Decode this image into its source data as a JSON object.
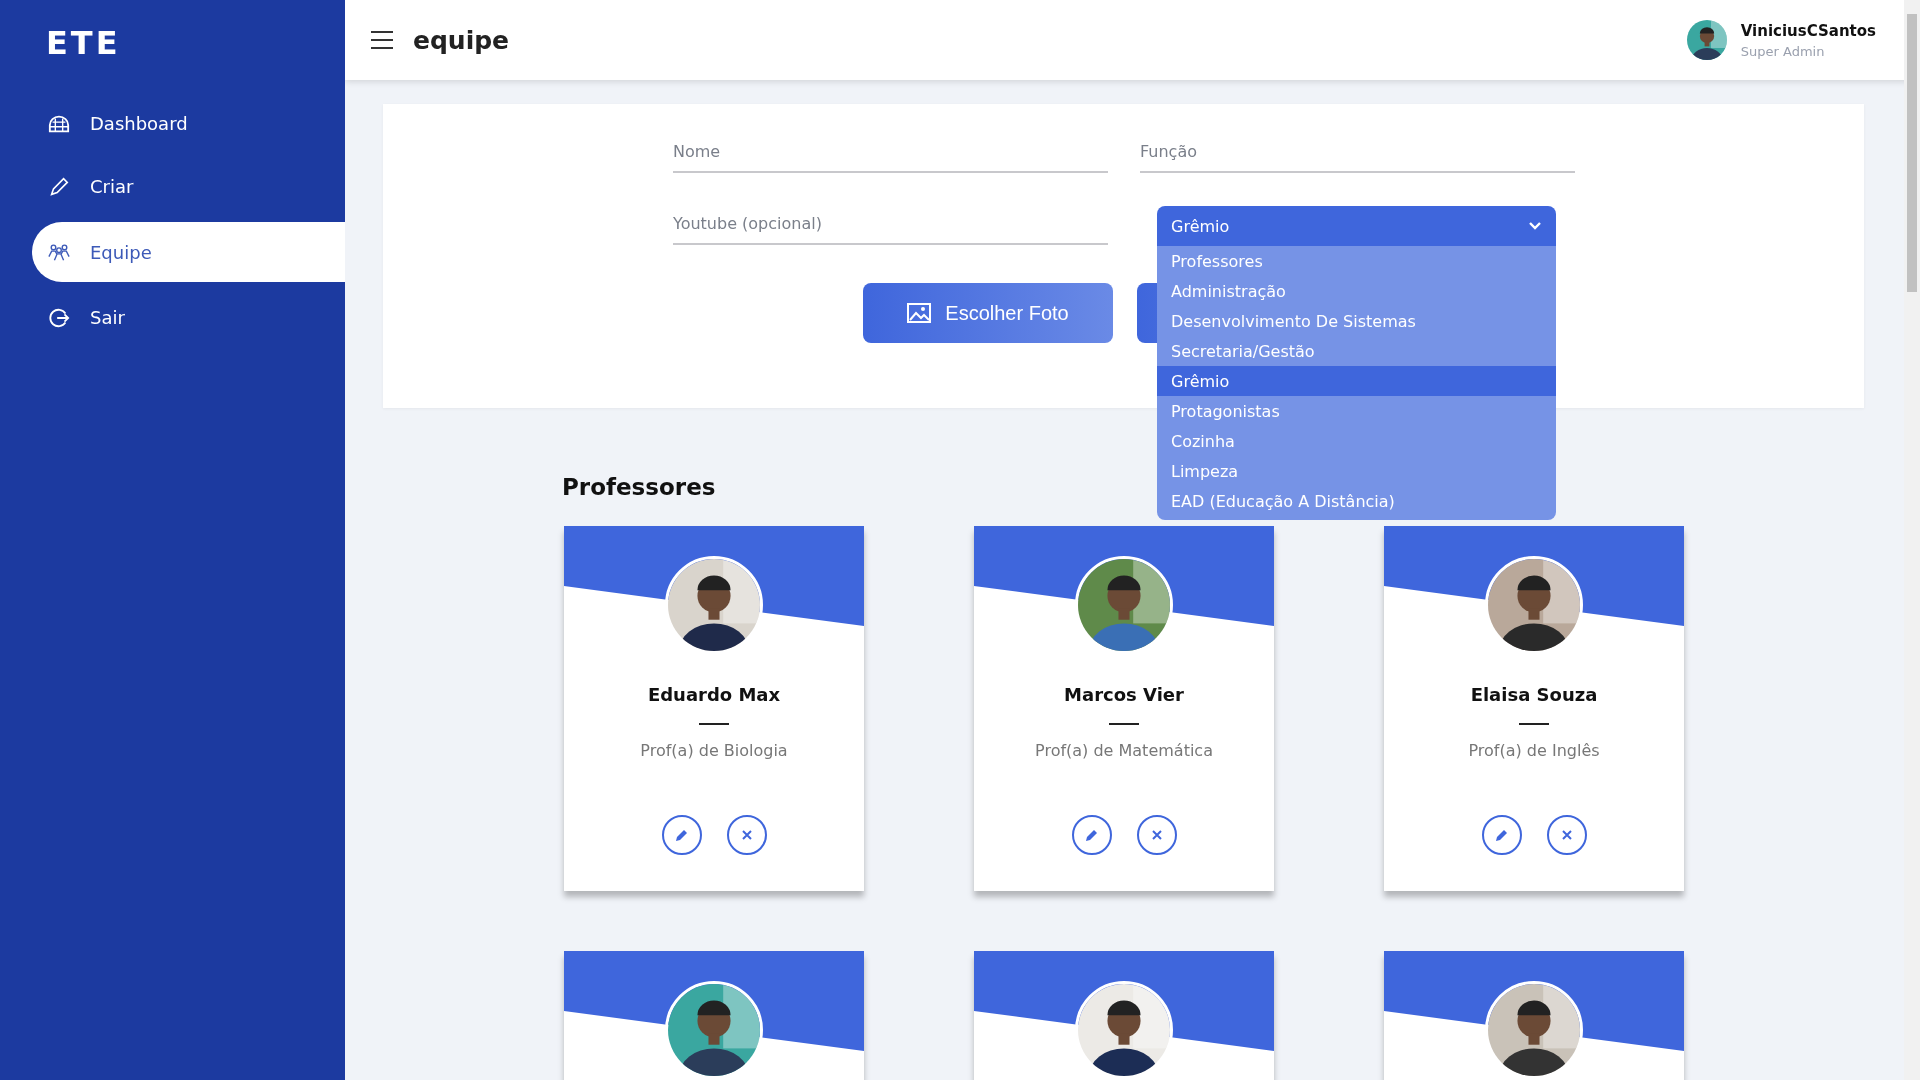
{
  "sidebar": {
    "logo": "ETE",
    "items": [
      {
        "label": "Dashboard",
        "selected": false
      },
      {
        "label": "Criar",
        "selected": false
      },
      {
        "label": "Equipe",
        "selected": true
      },
      {
        "label": "Sair",
        "selected": false
      }
    ]
  },
  "header": {
    "title": "equipe",
    "user": {
      "name": "ViniciusCSantos",
      "role": "Super Admin",
      "avatar": {
        "kind": "picture"
      }
    }
  },
  "form": {
    "fields": [
      {
        "placeholder": "Nome"
      },
      {
        "placeholder": "Função"
      },
      {
        "placeholder": "Youtube (opcional)"
      }
    ],
    "role_select": {
      "value": "Grêmio",
      "expanded": true,
      "options": [
        {
          "label": "Professores",
          "selected": false
        },
        {
          "label": "Administração",
          "selected": false
        },
        {
          "label": "Desenvolvimento De Sistemas",
          "selected": false
        },
        {
          "label": "Secretaria/Gestão",
          "selected": false
        },
        {
          "label": "Grêmio",
          "selected": true
        },
        {
          "label": "Protagonistas",
          "selected": false
        },
        {
          "label": "Cozinha",
          "selected": false
        },
        {
          "label": "Limpeza",
          "selected": false
        },
        {
          "label": "EAD (Educação A Distância)",
          "selected": false
        }
      ]
    },
    "buttons": [
      {
        "kind": "labeled",
        "label": "Escolher Foto"
      },
      {
        "kind": "covered"
      }
    ]
  },
  "section": {
    "title": "Professores",
    "members": [
      {
        "name": "Eduardo Max",
        "role": "Prof(a) de Biologia",
        "photo": {
          "kind": "picture"
        }
      },
      {
        "name": "Marcos Vier",
        "role": "Prof(a) de Matemática",
        "photo": {
          "kind": "picture"
        }
      },
      {
        "name": "Elaisa Souza",
        "role": "Prof(a) de Inglês",
        "photo": {
          "kind": "picture"
        }
      },
      {
        "photo": {
          "kind": "picture"
        }
      },
      {
        "photo": {
          "kind": "picture"
        }
      },
      {
        "photo": {
          "kind": "picture"
        }
      }
    ]
  }
}
